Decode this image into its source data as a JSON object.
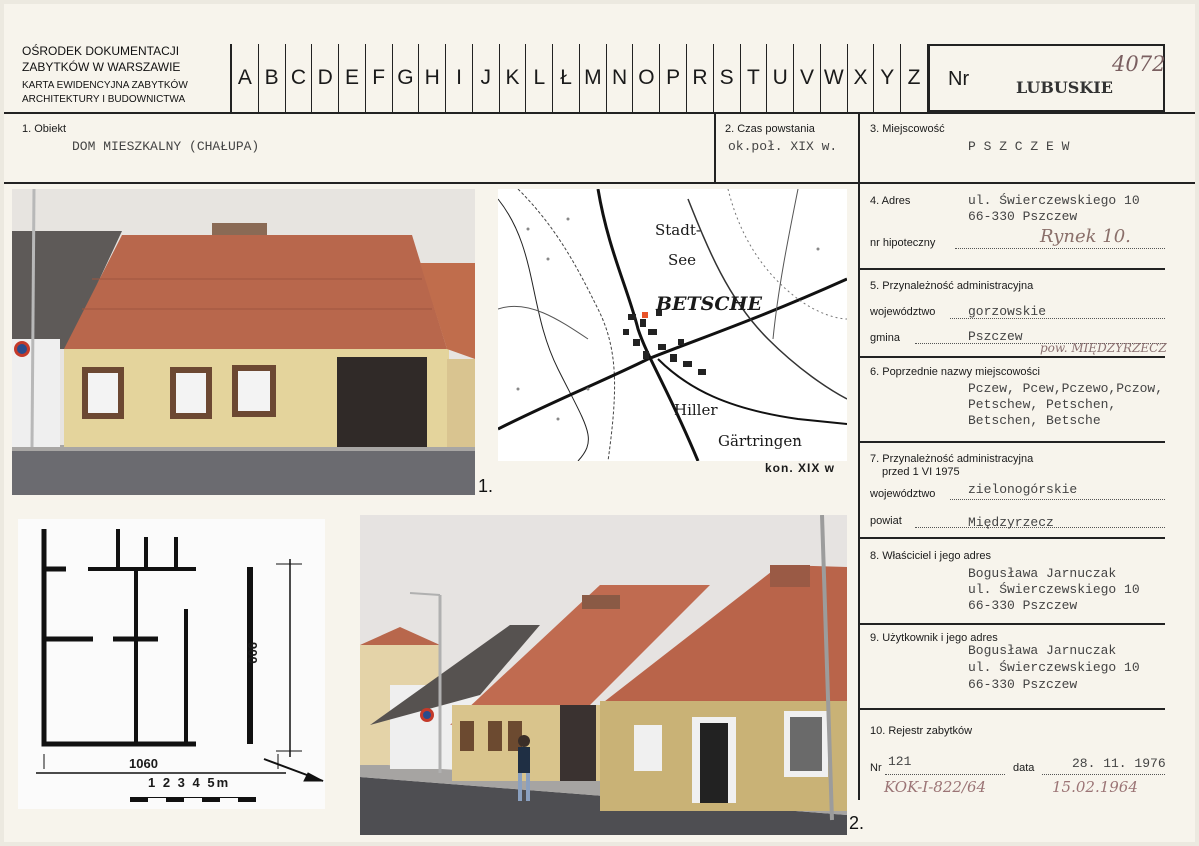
{
  "institution": {
    "line1": "OŚRODEK DOKUMENTACJI",
    "line2": "ZABYTKÓW W WARSZAWIE",
    "line3": "KARTA EWIDENCYJNA ZABYTKÓW",
    "line4": "ARCHITEKTURY I BUDOWNICTWA"
  },
  "alphabet": [
    "A",
    "B",
    "C",
    "D",
    "E",
    "F",
    "G",
    "H",
    "I",
    "J",
    "K",
    "L",
    "Ł",
    "M",
    "N",
    "O",
    "P",
    "R",
    "S",
    "T",
    "U",
    "V",
    "W",
    "X",
    "Y",
    "Z"
  ],
  "nr": {
    "label": "Nr",
    "region": "LUBUSKIE",
    "number": "4072"
  },
  "fields": {
    "obiekt": {
      "label": "1. Obiekt",
      "value": "DOM MIESZKALNY (CHAŁUPA)"
    },
    "czas": {
      "label": "2. Czas powstania",
      "value": "ok.poł. XIX w."
    },
    "miejscowosc": {
      "label": "3. Miejscowość",
      "value": "P S Z C Z E W"
    },
    "adres": {
      "label": "4. Adres",
      "line1": "ul. Świerczewskiego 10",
      "line2": "66-330 Pszczew",
      "hipoteczny_label": "nr hipoteczny",
      "hipoteczny_value": "Rynek 10."
    },
    "admin": {
      "label": "5. Przynależność administracyjna",
      "woj_label": "województwo",
      "woj_value": "gorzowskie",
      "gmina_label": "gmina",
      "gmina_value": "Pszczew",
      "note": "pow. MIĘDZYRZECZ"
    },
    "poprzednie": {
      "label": "6. Poprzednie nazwy miejscowości",
      "line1": "Pczew, Pcew,Pczewo,Pczow,",
      "line2": "Petschew, Petschen,",
      "line3": "Betschen, Betsche"
    },
    "admin75": {
      "label1": "7. Przynależność administracyjna",
      "label2": "przed 1 VI 1975",
      "woj_label": "województwo",
      "woj_value": "zielonogórskie",
      "powiat_label": "powiat",
      "powiat_value": "Międzyrzecz"
    },
    "wlasciciel": {
      "label": "8. Właściciel i jego adres",
      "line1": "Bogusława Jarnuczak",
      "line2": "ul. Świerczewskiego 10",
      "line3": "66-330 Pszczew"
    },
    "uzytkownik": {
      "label": "9. Użytkownik i jego adres",
      "line1": "Bogusława Jarnuczak",
      "line2": "ul. Świerczewskiego 10",
      "line3": "66-330 Pszczew"
    },
    "rejestr": {
      "label": "10. Rejestr zabytków",
      "nr_label": "Nr",
      "nr_value": "121",
      "data_label": "data",
      "data_value": "28. 11. 1976",
      "hand_nr": "KOK-I-822/64",
      "hand_data": "15.02.1964"
    }
  },
  "map": {
    "label1": "Stadt-",
    "label2": "See",
    "town": "BETSCHE",
    "village1": "Hiller",
    "village2": "Gärtringen",
    "caption": "kon. XIX w"
  },
  "plan": {
    "width_label": "1060",
    "height_label": "900",
    "scale_label": "1 2 3 4 5m"
  },
  "figures": {
    "fig1": "1.",
    "fig2": "2."
  },
  "colors": {
    "paper": "#f7f4ec",
    "roof": "#b8664a",
    "wall": "#e6d59a",
    "ink": "#222222"
  }
}
